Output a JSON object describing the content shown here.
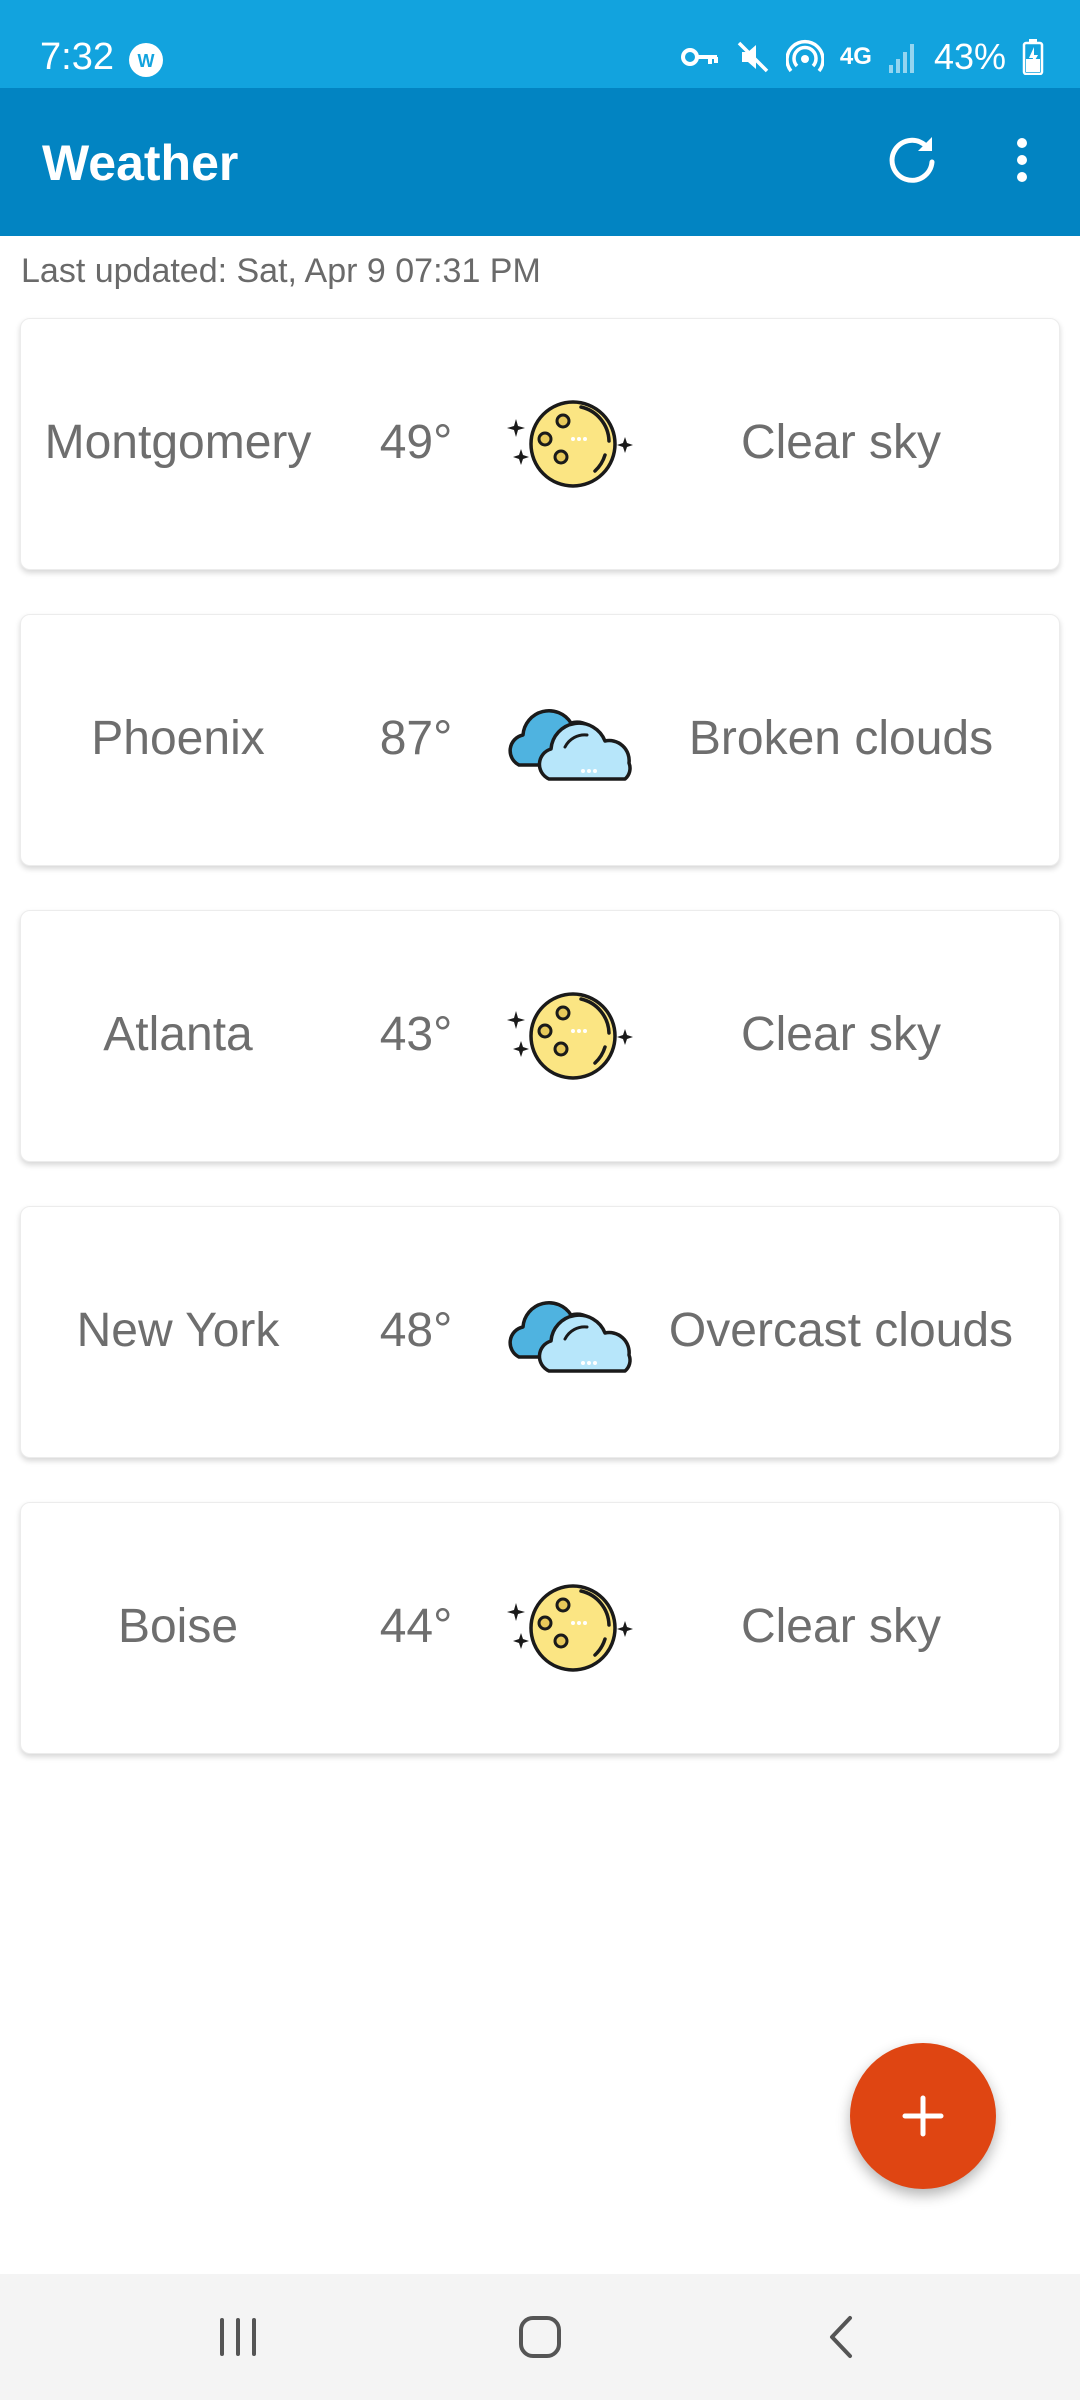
{
  "status_bar": {
    "time": "7:32",
    "battery": "43%",
    "network": "4G",
    "icons": [
      "vpn-key-icon",
      "mute-icon",
      "hotspot-icon",
      "signal-icon",
      "battery-icon"
    ]
  },
  "app_bar": {
    "title": "Weather",
    "actions": [
      "refresh-icon",
      "more-vert-icon"
    ]
  },
  "last_updated": "Last updated: Sat, Apr 9 07:31 PM",
  "cities": [
    {
      "name": "Montgomery",
      "temp": "49°",
      "icon": "clear-night-moon-icon",
      "description": "Clear sky"
    },
    {
      "name": "Phoenix",
      "temp": "87°",
      "icon": "clouds-icon",
      "description": "Broken clouds"
    },
    {
      "name": "Atlanta",
      "temp": "43°",
      "icon": "clear-night-moon-icon",
      "description": "Clear sky"
    },
    {
      "name": "New York",
      "temp": "48°",
      "icon": "clouds-icon",
      "description": "Overcast clouds"
    },
    {
      "name": "Boise",
      "temp": "44°",
      "icon": "clear-night-moon-icon",
      "description": "Clear sky"
    }
  ],
  "fab": {
    "icon": "plus-icon"
  },
  "nav_bar": {
    "buttons": [
      "recent-apps-icon",
      "home-icon",
      "back-icon"
    ]
  },
  "colors": {
    "status_bar": "#12a3de",
    "app_bar": "#0284c2",
    "fab": "#df4512",
    "moon": "#fbe583",
    "cloud_front": "#b7e6fa",
    "cloud_back": "#4fb3e0"
  }
}
